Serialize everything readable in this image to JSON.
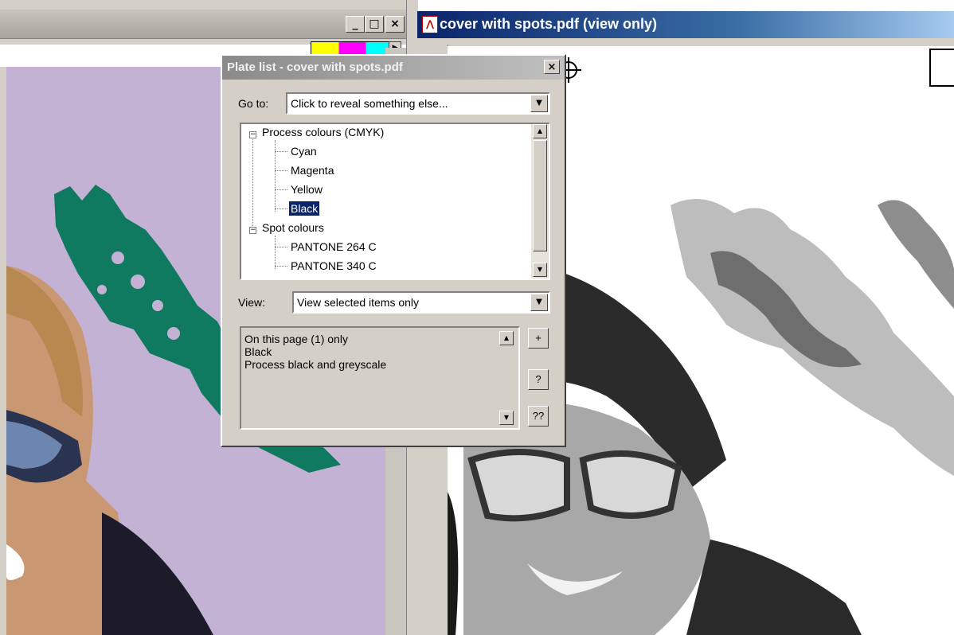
{
  "left_window": {
    "controls": {
      "minimize": "_",
      "restore": "□",
      "close": "×"
    }
  },
  "right_window": {
    "title": "cover with spots.pdf (view only)",
    "app_icon": "pdf-icon"
  },
  "dialog": {
    "title": "Plate list - cover with spots.pdf",
    "close": "×",
    "goto_label": "Go to:",
    "goto_value": "Click to reveal something else...",
    "tree": {
      "process_group": "Process colours (CMYK)",
      "process_items": [
        "Cyan",
        "Magenta",
        "Yellow",
        "Black"
      ],
      "selected": "Black",
      "spot_group": "Spot colours",
      "spot_items": [
        "PANTONE 264 C",
        "PANTONE 340 C"
      ]
    },
    "view_label": "View:",
    "view_value": "View selected items only",
    "info_lines": [
      "On this page (1) only",
      "Black",
      "Process black and greyscale"
    ],
    "buttons": {
      "plus": "+",
      "help": "?",
      "help_more": "??"
    }
  },
  "colors": {
    "left_background": "#c3b2d3",
    "green_spot": "#0f7a5f",
    "selection": "#0a246a",
    "titlebar_active": "#0a246a"
  }
}
